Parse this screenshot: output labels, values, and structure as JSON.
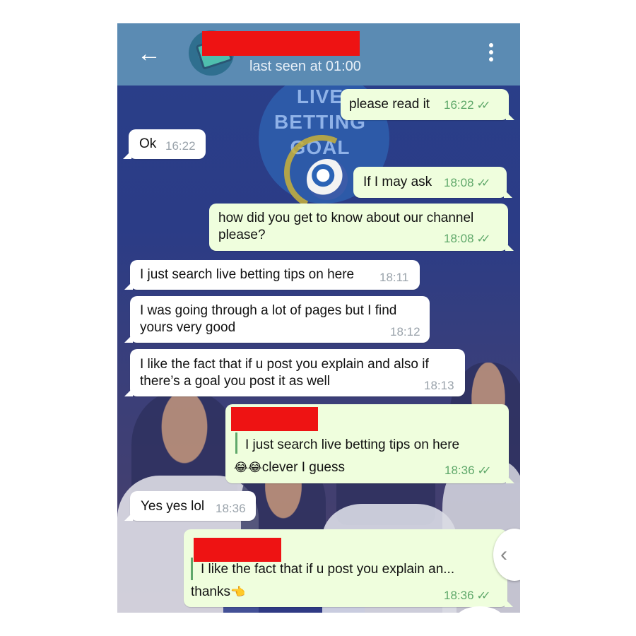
{
  "header": {
    "status": "last seen at 01:00",
    "back_icon": "arrow-left-icon",
    "menu_icon": "more-vertical-icon"
  },
  "background": {
    "logo_line1": "LIVE BETTING",
    "logo_line2": "GOAL"
  },
  "messages": [
    {
      "direction": "out",
      "text": "please read it",
      "time": "16:22",
      "ticks": "✓✓"
    },
    {
      "direction": "in",
      "text": "Ok",
      "time": "16:22"
    },
    {
      "direction": "out",
      "text": "If I may ask",
      "time": "18:08",
      "ticks": "✓✓"
    },
    {
      "direction": "out",
      "text_line1": "how did you get to know about our channel",
      "text_line2": "please?",
      "time": "18:08",
      "ticks": "✓✓"
    },
    {
      "direction": "in",
      "text": "I just search live betting tips on here",
      "time": "18:11"
    },
    {
      "direction": "in",
      "text_line1": "I was going through a lot of pages but I find",
      "text_line2": "yours very good",
      "time": "18:12"
    },
    {
      "direction": "in",
      "text_line1": "I like the fact that if u post you explain and also if",
      "text_line2": "there’s a goal you post it as well",
      "time": "18:13"
    },
    {
      "direction": "out",
      "quote": "I just search live betting tips on here",
      "emoji": "😂😂",
      "text": "clever I guess",
      "time": "18:36",
      "ticks": "✓✓"
    },
    {
      "direction": "in",
      "text": "Yes yes lol",
      "time": "18:36"
    },
    {
      "direction": "out",
      "quote": "I like the fact that if u post you explain an...",
      "text": "thanks",
      "emoji": "👈",
      "time": "18:36",
      "ticks": "✓✓"
    }
  ],
  "side_button_icon": "chevron-left-icon",
  "side_button_glyph": "‹"
}
